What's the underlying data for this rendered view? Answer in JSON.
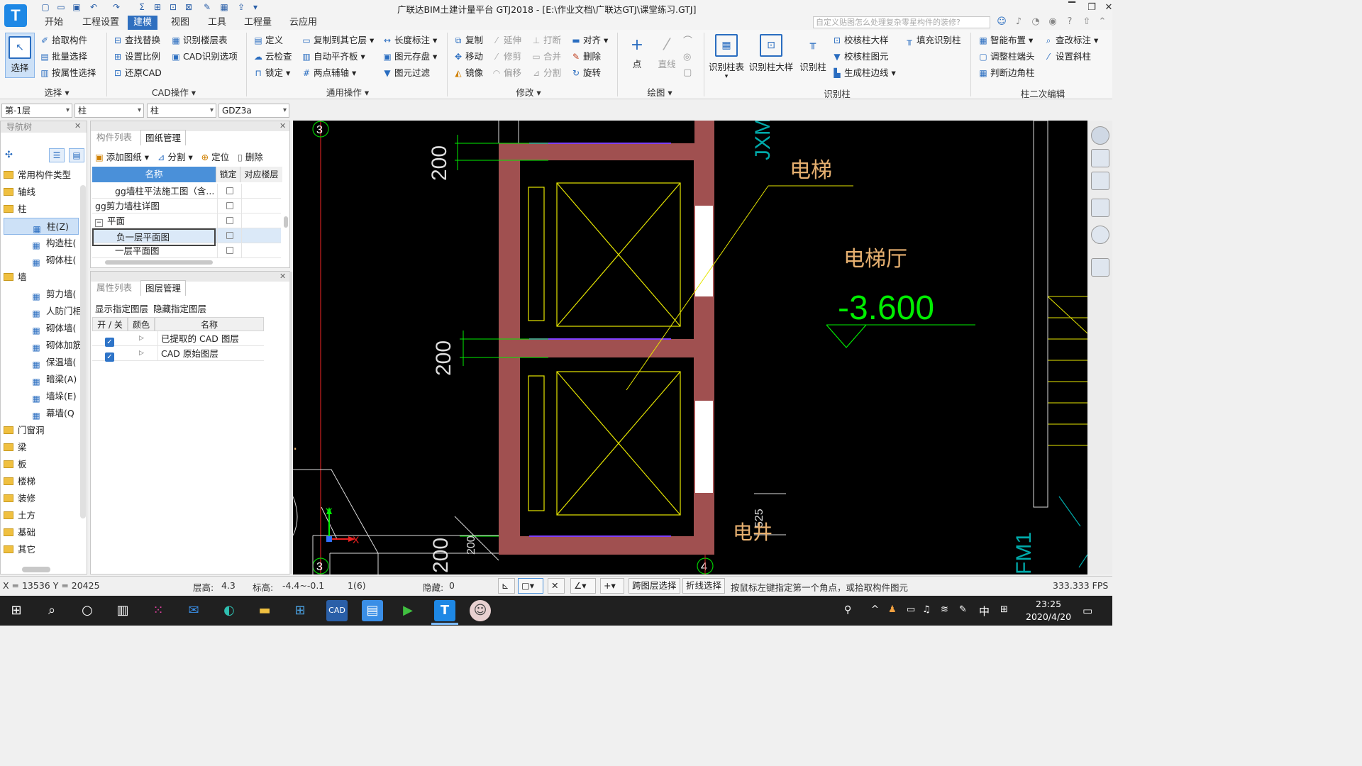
{
  "title": "广联达BIM土建计量平台 GTJ2018 - [E:\\作业文档\\广联达GTJ\\课堂练习.GTJ]",
  "app_logo": "T",
  "menu": {
    "tabs": [
      "开始",
      "工程设置",
      "建模",
      "视图",
      "工具",
      "工程量",
      "云应用"
    ],
    "help_placeholder": "自定义贴图怎么处理复杂零星构件的装修?"
  },
  "ribbon": {
    "select_label": "选择",
    "select_group": {
      "items": [
        "拾取构件",
        "批量选择",
        "按属性选择"
      ],
      "title": "选择"
    },
    "cad_group": {
      "items": [
        "查找替换",
        "识别楼层表",
        "设置比例",
        "CAD识别选项",
        "还原CAD"
      ],
      "title": "CAD操作"
    },
    "common_group": {
      "items": [
        "定义",
        "复制到其它层",
        "长度标注",
        "云检查",
        "自动平齐板",
        "图元存盘",
        "锁定",
        "两点辅轴",
        "图元过滤"
      ],
      "title": "通用操作"
    },
    "modify_group": {
      "items": [
        "复制",
        "延伸",
        "打断",
        "对齐",
        "移动",
        "修剪",
        "合并",
        "删除",
        "镜像",
        "偏移",
        "分割",
        "旋转"
      ],
      "title": "修改"
    },
    "draw_group": {
      "items": [
        "点",
        "直线"
      ],
      "title": "绘图"
    },
    "recog_group": {
      "items": [
        "识别柱表",
        "识别柱大样",
        "识别柱",
        "校核柱大样",
        "校核柱图元",
        "生成柱边线",
        "填充识别柱"
      ],
      "title": "识别柱"
    },
    "edit_group": {
      "items": [
        "智能布置",
        "查改标注",
        "调整柱端头",
        "设置斜柱",
        "判断边角柱"
      ],
      "title": "柱二次编辑"
    }
  },
  "selectors": {
    "floor": "第-1层",
    "type1": "柱",
    "type2": "柱",
    "component": "GDZ3a"
  },
  "nav": {
    "title": "导航树",
    "items": [
      {
        "label": "常用构件类型",
        "kind": "folder"
      },
      {
        "label": "轴线",
        "kind": "folder"
      },
      {
        "label": "柱",
        "kind": "folder"
      },
      {
        "label": "柱(Z)",
        "kind": "sub",
        "icon": "column-icon",
        "selected": true
      },
      {
        "label": "构造柱(",
        "kind": "sub",
        "icon": "construct-column-icon"
      },
      {
        "label": "砌体柱(",
        "kind": "sub",
        "icon": "masonry-column-icon"
      },
      {
        "label": "墙",
        "kind": "folder"
      },
      {
        "label": "剪力墙(",
        "kind": "sub",
        "icon": "shear-wall-icon"
      },
      {
        "label": "人防门相",
        "kind": "sub",
        "icon": "door-frame-icon"
      },
      {
        "label": "砌体墙(",
        "kind": "sub",
        "icon": "masonry-wall-icon"
      },
      {
        "label": "砌体加筋",
        "kind": "sub",
        "icon": "rebar-icon"
      },
      {
        "label": "保温墙(",
        "kind": "sub",
        "icon": "insulation-wall-icon"
      },
      {
        "label": "暗梁(A)",
        "kind": "sub",
        "icon": "hidden-beam-icon"
      },
      {
        "label": "墙垛(E)",
        "kind": "sub",
        "icon": "wall-pier-icon"
      },
      {
        "label": "幕墙(Q",
        "kind": "sub",
        "icon": "curtain-wall-icon"
      },
      {
        "label": "门窗洞",
        "kind": "folder"
      },
      {
        "label": "梁",
        "kind": "folder"
      },
      {
        "label": "板",
        "kind": "folder"
      },
      {
        "label": "楼梯",
        "kind": "folder"
      },
      {
        "label": "装修",
        "kind": "folder"
      },
      {
        "label": "土方",
        "kind": "folder"
      },
      {
        "label": "基础",
        "kind": "folder"
      },
      {
        "label": "其它",
        "kind": "folder"
      }
    ]
  },
  "drawings": {
    "tabs": [
      "构件列表",
      "图纸管理"
    ],
    "toolbar": [
      "添加图纸",
      "分割",
      "定位",
      "删除"
    ],
    "headers": [
      "名称",
      "锁定",
      "对应楼层"
    ],
    "rows": [
      {
        "name": "gg墙柱平法施工图（含...",
        "indent": 2
      },
      {
        "name": "gg剪力墙柱详图",
        "indent": 0
      },
      {
        "name": "平面",
        "indent": 0,
        "toggle": "−"
      },
      {
        "name": "负一层平面图",
        "indent": 2,
        "selected": true
      },
      {
        "name": "一层平面图",
        "indent": 2
      }
    ]
  },
  "layers": {
    "tabs": [
      "属性列表",
      "图层管理"
    ],
    "actions": [
      "显示指定图层",
      "隐藏指定图层"
    ],
    "headers": [
      "开 / 关",
      "颜色",
      "名称"
    ],
    "rows": [
      {
        "name": "已提取的 CAD 图层"
      },
      {
        "name": "CAD 原始图层"
      }
    ]
  },
  "cad": {
    "axis_top": "3",
    "axis_bottom": "3",
    "axis_right": "4",
    "dim1": "200",
    "dim2": "200",
    "dim3": "200",
    "dim4": "200",
    "dim5": "525",
    "label_elevator": "电梯",
    "label_hall": "电梯厅",
    "elevation": "-3.600",
    "label_shaft": "电井",
    "label_jxm": "JXM",
    "label_fm": "FM1",
    "colors": {
      "wall": "#a05050",
      "dim": "#00ff00",
      "yellow": "#e6e600",
      "text": "#e6b070"
    }
  },
  "status": {
    "coords": "X = 13536 Y = 20425",
    "floor_height": "层高:",
    "floor_height_val": "4.3",
    "elev": "标高:",
    "elev_val": "-4.4~-0.1",
    "count": "1(6)",
    "hidden": "隐藏:",
    "hidden_val": "0",
    "btn_cross": "跨图层选择",
    "btn_poly": "折线选择",
    "hint": "按鼠标左键指定第一个角点，或拾取构件图元",
    "fps": "333.333 FPS"
  },
  "taskbar": {
    "time": "23:25",
    "date": "2020/4/20",
    "ime": "中"
  }
}
